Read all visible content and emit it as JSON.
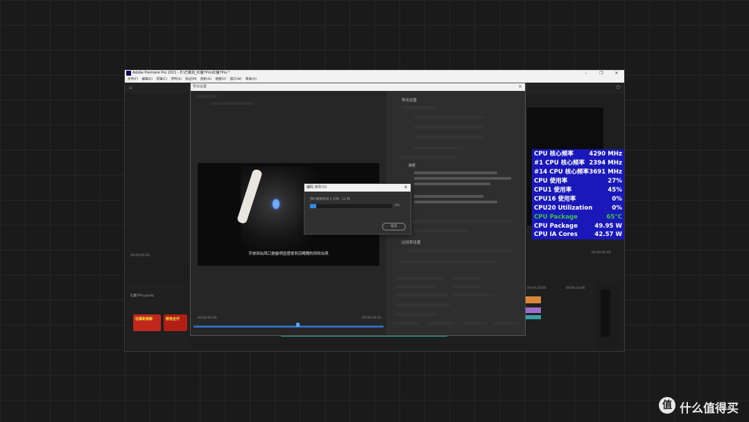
{
  "window": {
    "title": "Adobe Premiere Pro 2021 - E:\\已策划_红魔7Pro\\红魔7Pro *",
    "controls": {
      "minimize": "–",
      "maximize": "❐",
      "close": "✕"
    }
  },
  "menu": [
    "文件(F)",
    "编辑(E)",
    "剪辑(C)",
    "序列(S)",
    "标记(M)",
    "图形(G)",
    "视图(V)",
    "窗口(W)",
    "帮助(H)"
  ],
  "export_dialog": {
    "title": "导出设置",
    "close": "✕",
    "subtitle": "手放到出风口是能明显感觉到凉飕飕的风吹出来",
    "settings_heading": "导出设置",
    "video_heading": "比特率设置",
    "timecode_left": "00:00:04:28",
    "timecode_right": "00:00:06:24",
    "summary_label": "摘要"
  },
  "encoding": {
    "title": "编码 序列 01",
    "close": "✕",
    "remaining": "预计剩余时间 2 分钟，12 秒",
    "progress": 0.0,
    "percent_label": "0%",
    "cancel_label": "取消"
  },
  "premiere": {
    "left_timecode": "00;00;00;00",
    "project_label": "红魔7Pro.prproj",
    "right_timecode": "00:00:00:00",
    "timeline_tc1": "00;00;20;00",
    "timeline_tc2": "00;00;24;00",
    "thumb1_text": "狂暴新旗舰",
    "thumb2_text": "散热全开"
  },
  "hw_monitor": [
    {
      "label": "CPU 核心频率",
      "value": "4290 MHz",
      "color": "#ffffff"
    },
    {
      "label": "#1 CPU 核心频率",
      "value": "2394 MHz",
      "color": "#ffffff"
    },
    {
      "label": "#14 CPU 核心频率",
      "value": "3691 MHz",
      "color": "#ffffff"
    },
    {
      "label": "CPU 使用率",
      "value": "27%",
      "color": "#ffffff"
    },
    {
      "label": "CPU1 使用率",
      "value": "45%",
      "color": "#ffffff"
    },
    {
      "label": "CPU16 使用率",
      "value": "0%",
      "color": "#ffffff"
    },
    {
      "label": "CPU20 Utilization",
      "value": "0%",
      "color": "#ffffff"
    },
    {
      "label": "CPU Package",
      "value": "65°C",
      "color": "#39c44a"
    },
    {
      "label": "CPU Package",
      "value": "49.95 W",
      "color": "#ffffff"
    },
    {
      "label": "CPU IA Cores",
      "value": "42.57 W",
      "color": "#ffffff"
    }
  ],
  "watermark": {
    "logo": "值",
    "text": "什么值得买"
  },
  "colors": {
    "accent": "#2f8ae6",
    "hw_bg": "#1a18b8",
    "dark_bg": "#1a1a1a"
  }
}
